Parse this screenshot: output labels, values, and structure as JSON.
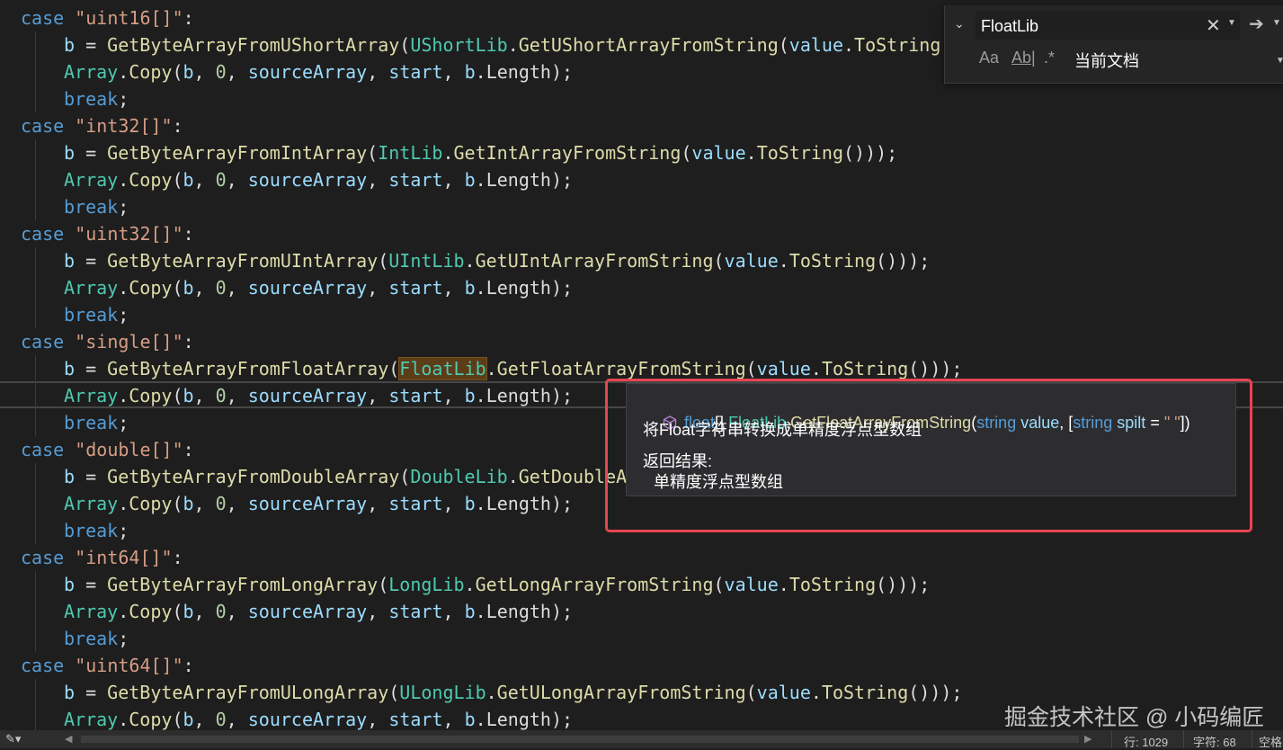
{
  "colors": {
    "keyword": "#569cd6",
    "string": "#d69d85",
    "type": "#4ec9b0",
    "method": "#dcdcaa",
    "variable": "#9cdcfe",
    "number": "#b5cea8",
    "plain": "#dcdcdc",
    "highlight_box": "#e64553"
  },
  "code_lines": [
    {
      "indent": 0,
      "tokens": [
        {
          "t": "case ",
          "c": "keyword"
        },
        {
          "t": "\"uint16[]\"",
          "c": "string"
        },
        {
          "t": ":",
          "c": "plain"
        }
      ]
    },
    {
      "indent": 1,
      "tokens": [
        {
          "t": "b",
          "c": "variable"
        },
        {
          "t": " = ",
          "c": "plain"
        },
        {
          "t": "GetByteArrayFromUShortArray",
          "c": "method"
        },
        {
          "t": "(",
          "c": "plain"
        },
        {
          "t": "UShortLib",
          "c": "type"
        },
        {
          "t": ".",
          "c": "plain"
        },
        {
          "t": "GetUShortArrayFromString",
          "c": "method"
        },
        {
          "t": "(",
          "c": "plain"
        },
        {
          "t": "value",
          "c": "variable"
        },
        {
          "t": ".",
          "c": "plain"
        },
        {
          "t": "ToString",
          "c": "method"
        },
        {
          "t": "()));",
          "c": "plain"
        }
      ]
    },
    {
      "indent": 1,
      "tokens": [
        {
          "t": "Array",
          "c": "type"
        },
        {
          "t": ".",
          "c": "plain"
        },
        {
          "t": "Copy",
          "c": "method"
        },
        {
          "t": "(",
          "c": "plain"
        },
        {
          "t": "b",
          "c": "variable"
        },
        {
          "t": ", ",
          "c": "plain"
        },
        {
          "t": "0",
          "c": "number"
        },
        {
          "t": ", ",
          "c": "plain"
        },
        {
          "t": "sourceArray",
          "c": "variable"
        },
        {
          "t": ", ",
          "c": "plain"
        },
        {
          "t": "start",
          "c": "variable"
        },
        {
          "t": ", ",
          "c": "plain"
        },
        {
          "t": "b",
          "c": "variable"
        },
        {
          "t": ".",
          "c": "plain"
        },
        {
          "t": "Length",
          "c": "plain"
        },
        {
          "t": ");",
          "c": "plain"
        }
      ]
    },
    {
      "indent": 1,
      "tokens": [
        {
          "t": "break",
          "c": "keyword"
        },
        {
          "t": ";",
          "c": "plain"
        }
      ]
    },
    {
      "indent": 0,
      "tokens": [
        {
          "t": "case ",
          "c": "keyword"
        },
        {
          "t": "\"int32[]\"",
          "c": "string"
        },
        {
          "t": ":",
          "c": "plain"
        }
      ]
    },
    {
      "indent": 1,
      "tokens": [
        {
          "t": "b",
          "c": "variable"
        },
        {
          "t": " = ",
          "c": "plain"
        },
        {
          "t": "GetByteArrayFromIntArray",
          "c": "method"
        },
        {
          "t": "(",
          "c": "plain"
        },
        {
          "t": "IntLib",
          "c": "type"
        },
        {
          "t": ".",
          "c": "plain"
        },
        {
          "t": "GetIntArrayFromString",
          "c": "method"
        },
        {
          "t": "(",
          "c": "plain"
        },
        {
          "t": "value",
          "c": "variable"
        },
        {
          "t": ".",
          "c": "plain"
        },
        {
          "t": "ToString",
          "c": "method"
        },
        {
          "t": "()));",
          "c": "plain"
        }
      ]
    },
    {
      "indent": 1,
      "tokens": [
        {
          "t": "Array",
          "c": "type"
        },
        {
          "t": ".",
          "c": "plain"
        },
        {
          "t": "Copy",
          "c": "method"
        },
        {
          "t": "(",
          "c": "plain"
        },
        {
          "t": "b",
          "c": "variable"
        },
        {
          "t": ", ",
          "c": "plain"
        },
        {
          "t": "0",
          "c": "number"
        },
        {
          "t": ", ",
          "c": "plain"
        },
        {
          "t": "sourceArray",
          "c": "variable"
        },
        {
          "t": ", ",
          "c": "plain"
        },
        {
          "t": "start",
          "c": "variable"
        },
        {
          "t": ", ",
          "c": "plain"
        },
        {
          "t": "b",
          "c": "variable"
        },
        {
          "t": ".",
          "c": "plain"
        },
        {
          "t": "Length",
          "c": "plain"
        },
        {
          "t": ");",
          "c": "plain"
        }
      ]
    },
    {
      "indent": 1,
      "tokens": [
        {
          "t": "break",
          "c": "keyword"
        },
        {
          "t": ";",
          "c": "plain"
        }
      ]
    },
    {
      "indent": 0,
      "tokens": [
        {
          "t": "case ",
          "c": "keyword"
        },
        {
          "t": "\"uint32[]\"",
          "c": "string"
        },
        {
          "t": ":",
          "c": "plain"
        }
      ]
    },
    {
      "indent": 1,
      "tokens": [
        {
          "t": "b",
          "c": "variable"
        },
        {
          "t": " = ",
          "c": "plain"
        },
        {
          "t": "GetByteArrayFromUIntArray",
          "c": "method"
        },
        {
          "t": "(",
          "c": "plain"
        },
        {
          "t": "UIntLib",
          "c": "type"
        },
        {
          "t": ".",
          "c": "plain"
        },
        {
          "t": "GetUIntArrayFromString",
          "c": "method"
        },
        {
          "t": "(",
          "c": "plain"
        },
        {
          "t": "value",
          "c": "variable"
        },
        {
          "t": ".",
          "c": "plain"
        },
        {
          "t": "ToString",
          "c": "method"
        },
        {
          "t": "()));",
          "c": "plain"
        }
      ]
    },
    {
      "indent": 1,
      "tokens": [
        {
          "t": "Array",
          "c": "type"
        },
        {
          "t": ".",
          "c": "plain"
        },
        {
          "t": "Copy",
          "c": "method"
        },
        {
          "t": "(",
          "c": "plain"
        },
        {
          "t": "b",
          "c": "variable"
        },
        {
          "t": ", ",
          "c": "plain"
        },
        {
          "t": "0",
          "c": "number"
        },
        {
          "t": ", ",
          "c": "plain"
        },
        {
          "t": "sourceArray",
          "c": "variable"
        },
        {
          "t": ", ",
          "c": "plain"
        },
        {
          "t": "start",
          "c": "variable"
        },
        {
          "t": ", ",
          "c": "plain"
        },
        {
          "t": "b",
          "c": "variable"
        },
        {
          "t": ".",
          "c": "plain"
        },
        {
          "t": "Length",
          "c": "plain"
        },
        {
          "t": ");",
          "c": "plain"
        }
      ]
    },
    {
      "indent": 1,
      "tokens": [
        {
          "t": "break",
          "c": "keyword"
        },
        {
          "t": ";",
          "c": "plain"
        }
      ]
    },
    {
      "indent": 0,
      "tokens": [
        {
          "t": "case ",
          "c": "keyword"
        },
        {
          "t": "\"single[]\"",
          "c": "string"
        },
        {
          "t": ":",
          "c": "plain"
        }
      ]
    },
    {
      "indent": 1,
      "tokens": [
        {
          "t": "b",
          "c": "variable"
        },
        {
          "t": " = ",
          "c": "plain"
        },
        {
          "t": "GetByteArrayFromFloatArray",
          "c": "method"
        },
        {
          "t": "(",
          "c": "plain"
        },
        {
          "t": "FloatLib",
          "c": "type",
          "hl": true
        },
        {
          "t": ".",
          "c": "plain"
        },
        {
          "t": "GetFloatArrayFromString",
          "c": "method"
        },
        {
          "t": "(",
          "c": "plain"
        },
        {
          "t": "value",
          "c": "variable"
        },
        {
          "t": ".",
          "c": "plain"
        },
        {
          "t": "ToString",
          "c": "method"
        },
        {
          "t": "()));",
          "c": "plain"
        }
      ]
    },
    {
      "indent": 1,
      "tokens": [
        {
          "t": "Array",
          "c": "type"
        },
        {
          "t": ".",
          "c": "plain"
        },
        {
          "t": "Copy",
          "c": "method"
        },
        {
          "t": "(",
          "c": "plain"
        },
        {
          "t": "b",
          "c": "variable"
        },
        {
          "t": ", ",
          "c": "plain"
        },
        {
          "t": "0",
          "c": "number"
        },
        {
          "t": ", ",
          "c": "plain"
        },
        {
          "t": "sourceArray",
          "c": "variable"
        },
        {
          "t": ", ",
          "c": "plain"
        },
        {
          "t": "start",
          "c": "variable"
        },
        {
          "t": ", ",
          "c": "plain"
        },
        {
          "t": "b",
          "c": "variable"
        },
        {
          "t": ".",
          "c": "plain"
        },
        {
          "t": "Length",
          "c": "plain"
        },
        {
          "t": ");",
          "c": "plain"
        }
      ]
    },
    {
      "indent": 1,
      "tokens": [
        {
          "t": "break",
          "c": "keyword"
        },
        {
          "t": ";",
          "c": "plain"
        }
      ]
    },
    {
      "indent": 0,
      "tokens": [
        {
          "t": "case ",
          "c": "keyword"
        },
        {
          "t": "\"double[]\"",
          "c": "string"
        },
        {
          "t": ":",
          "c": "plain"
        }
      ]
    },
    {
      "indent": 1,
      "tokens": [
        {
          "t": "b",
          "c": "variable"
        },
        {
          "t": " = ",
          "c": "plain"
        },
        {
          "t": "GetByteArrayFromDoubleArray",
          "c": "method"
        },
        {
          "t": "(",
          "c": "plain"
        },
        {
          "t": "DoubleLib",
          "c": "type"
        },
        {
          "t": ".",
          "c": "plain"
        },
        {
          "t": "GetDoubleA",
          "c": "method"
        }
      ]
    },
    {
      "indent": 1,
      "tokens": [
        {
          "t": "Array",
          "c": "type"
        },
        {
          "t": ".",
          "c": "plain"
        },
        {
          "t": "Copy",
          "c": "method"
        },
        {
          "t": "(",
          "c": "plain"
        },
        {
          "t": "b",
          "c": "variable"
        },
        {
          "t": ", ",
          "c": "plain"
        },
        {
          "t": "0",
          "c": "number"
        },
        {
          "t": ", ",
          "c": "plain"
        },
        {
          "t": "sourceArray",
          "c": "variable"
        },
        {
          "t": ", ",
          "c": "plain"
        },
        {
          "t": "start",
          "c": "variable"
        },
        {
          "t": ", ",
          "c": "plain"
        },
        {
          "t": "b",
          "c": "variable"
        },
        {
          "t": ".",
          "c": "plain"
        },
        {
          "t": "Length",
          "c": "plain"
        },
        {
          "t": ");",
          "c": "plain"
        }
      ]
    },
    {
      "indent": 1,
      "tokens": [
        {
          "t": "break",
          "c": "keyword"
        },
        {
          "t": ";",
          "c": "plain"
        }
      ]
    },
    {
      "indent": 0,
      "tokens": [
        {
          "t": "case ",
          "c": "keyword"
        },
        {
          "t": "\"int64[]\"",
          "c": "string"
        },
        {
          "t": ":",
          "c": "plain"
        }
      ]
    },
    {
      "indent": 1,
      "tokens": [
        {
          "t": "b",
          "c": "variable"
        },
        {
          "t": " = ",
          "c": "plain"
        },
        {
          "t": "GetByteArrayFromLongArray",
          "c": "method"
        },
        {
          "t": "(",
          "c": "plain"
        },
        {
          "t": "LongLib",
          "c": "type"
        },
        {
          "t": ".",
          "c": "plain"
        },
        {
          "t": "GetLongArrayFromString",
          "c": "method"
        },
        {
          "t": "(",
          "c": "plain"
        },
        {
          "t": "value",
          "c": "variable"
        },
        {
          "t": ".",
          "c": "plain"
        },
        {
          "t": "ToString",
          "c": "method"
        },
        {
          "t": "()));",
          "c": "plain"
        }
      ]
    },
    {
      "indent": 1,
      "tokens": [
        {
          "t": "Array",
          "c": "type"
        },
        {
          "t": ".",
          "c": "plain"
        },
        {
          "t": "Copy",
          "c": "method"
        },
        {
          "t": "(",
          "c": "plain"
        },
        {
          "t": "b",
          "c": "variable"
        },
        {
          "t": ", ",
          "c": "plain"
        },
        {
          "t": "0",
          "c": "number"
        },
        {
          "t": ", ",
          "c": "plain"
        },
        {
          "t": "sourceArray",
          "c": "variable"
        },
        {
          "t": ", ",
          "c": "plain"
        },
        {
          "t": "start",
          "c": "variable"
        },
        {
          "t": ", ",
          "c": "plain"
        },
        {
          "t": "b",
          "c": "variable"
        },
        {
          "t": ".",
          "c": "plain"
        },
        {
          "t": "Length",
          "c": "plain"
        },
        {
          "t": ");",
          "c": "plain"
        }
      ]
    },
    {
      "indent": 1,
      "tokens": [
        {
          "t": "break",
          "c": "keyword"
        },
        {
          "t": ";",
          "c": "plain"
        }
      ]
    },
    {
      "indent": 0,
      "tokens": [
        {
          "t": "case ",
          "c": "keyword"
        },
        {
          "t": "\"uint64[]\"",
          "c": "string"
        },
        {
          "t": ":",
          "c": "plain"
        }
      ]
    },
    {
      "indent": 1,
      "tokens": [
        {
          "t": "b",
          "c": "variable"
        },
        {
          "t": " = ",
          "c": "plain"
        },
        {
          "t": "GetByteArrayFromULongArray",
          "c": "method"
        },
        {
          "t": "(",
          "c": "plain"
        },
        {
          "t": "ULongLib",
          "c": "type"
        },
        {
          "t": ".",
          "c": "plain"
        },
        {
          "t": "GetULongArrayFromString",
          "c": "method"
        },
        {
          "t": "(",
          "c": "plain"
        },
        {
          "t": "value",
          "c": "variable"
        },
        {
          "t": ".",
          "c": "plain"
        },
        {
          "t": "ToString",
          "c": "method"
        },
        {
          "t": "()));",
          "c": "plain"
        }
      ]
    },
    {
      "indent": 1,
      "tokens": [
        {
          "t": "Array",
          "c": "type"
        },
        {
          "t": ".",
          "c": "plain"
        },
        {
          "t": "Copy",
          "c": "method"
        },
        {
          "t": "(",
          "c": "plain"
        },
        {
          "t": "b",
          "c": "variable"
        },
        {
          "t": ", ",
          "c": "plain"
        },
        {
          "t": "0",
          "c": "number"
        },
        {
          "t": ", ",
          "c": "plain"
        },
        {
          "t": "sourceArray",
          "c": "variable"
        },
        {
          "t": ", ",
          "c": "plain"
        },
        {
          "t": "start",
          "c": "variable"
        },
        {
          "t": ", ",
          "c": "plain"
        },
        {
          "t": "b",
          "c": "variable"
        },
        {
          "t": ".",
          "c": "plain"
        },
        {
          "t": "Length",
          "c": "plain"
        },
        {
          "t": ");",
          "c": "plain"
        }
      ]
    }
  ],
  "find_widget": {
    "query": "FloatLib",
    "close_glyph": "✕",
    "next_glyph": "➔",
    "match_case_label": "Aa",
    "whole_word_label": "Ab|",
    "regex_label": ".*",
    "scope": "当前文档",
    "icons": [
      "chevron-down-icon",
      "close-icon",
      "arrow-right-icon",
      "match-case-icon",
      "whole-word-icon",
      "regex-icon"
    ]
  },
  "tooltip": {
    "signature": [
      {
        "t": "float",
        "c": "keyword"
      },
      {
        "t": "[] ",
        "c": "plain"
      },
      {
        "t": "FloatLib",
        "c": "type"
      },
      {
        "t": ".",
        "c": "plain"
      },
      {
        "t": "GetFloatArrayFromString",
        "c": "method"
      },
      {
        "t": "(",
        "c": "plain"
      },
      {
        "t": "string",
        "c": "keyword"
      },
      {
        "t": " ",
        "c": "plain"
      },
      {
        "t": "value",
        "c": "variable"
      },
      {
        "t": ", [",
        "c": "plain"
      },
      {
        "t": "string",
        "c": "keyword"
      },
      {
        "t": " ",
        "c": "plain"
      },
      {
        "t": "spilt",
        "c": "variable"
      },
      {
        "t": " = ",
        "c": "plain"
      },
      {
        "t": "\" \"",
        "c": "string"
      },
      {
        "t": "])",
        "c": "plain"
      }
    ],
    "description": "将Float字符串转换成单精度浮点型数组",
    "returns_heading": "返回结果:",
    "returns_value": "单精度浮点型数组"
  },
  "watermark": "掘金技术社区 @ 小码编匠",
  "status_bar": {
    "line": "行: 1029",
    "char": "字符: 68",
    "spaces": "空格"
  }
}
